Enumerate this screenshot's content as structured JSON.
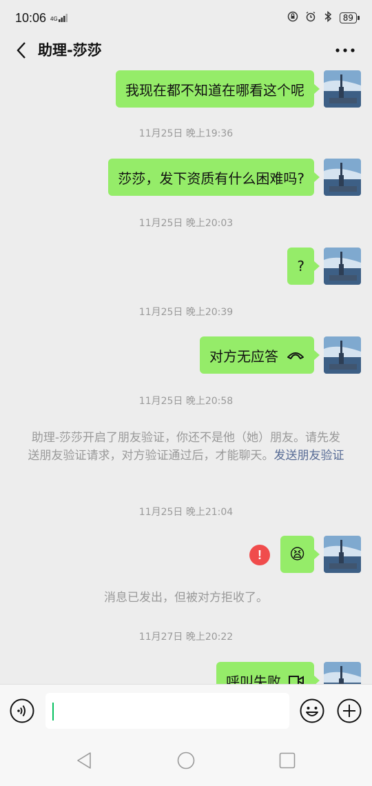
{
  "status_bar": {
    "time": "10:06",
    "signal_label": "4G",
    "battery": "89"
  },
  "header": {
    "title": "助理-莎莎"
  },
  "messages": [
    {
      "text": "我现在都不知道在哪看这个呢"
    },
    {
      "time": "11月25日 晚上19:36",
      "text": "莎莎，发下资质有什么困难吗?"
    },
    {
      "time": "11月25日 晚上20:03",
      "text": "?"
    },
    {
      "time": "11月25日 晚上20:39",
      "text": "对方无应答"
    },
    {
      "time": "11月25日 晚上20:58"
    },
    {
      "time": "11月25日 晚上21:04",
      "text": "😫"
    },
    {
      "time": "11月27日 晚上20:22",
      "text": "呼叫失败"
    }
  ],
  "notice": {
    "text": "助理-莎莎开启了朋友验证，你还不是他（她）朋友。请先发送朋友验证请求，对方验证通过后，才能聊天。",
    "link": "发送朋友验证"
  },
  "rejected_notice": "消息已发出，但被对方拒收了。",
  "icons": {
    "back": "chevron-left-icon",
    "more": "more-dots-icon",
    "voice": "voice-icon",
    "emoji": "emoji-icon",
    "plus": "plus-icon",
    "error": "error-icon",
    "hangup": "hangup-icon",
    "video": "video-call-icon"
  },
  "colors": {
    "bubble": "#95ec69",
    "error": "#f04c4c",
    "link": "#576b95",
    "caret": "#07c160"
  }
}
